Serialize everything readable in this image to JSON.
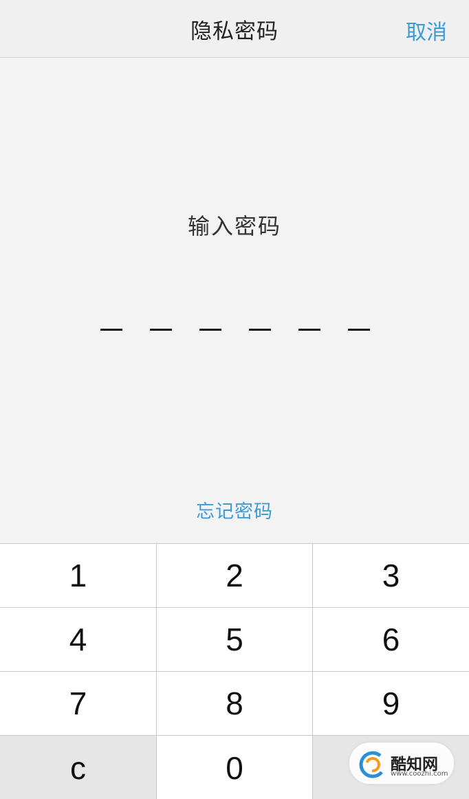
{
  "header": {
    "title": "隐私密码",
    "cancel_label": "取消"
  },
  "main": {
    "prompt": "输入密码",
    "pin_length": 6,
    "forgot_label": "忘记密码"
  },
  "keypad": {
    "keys": [
      "1",
      "2",
      "3",
      "4",
      "5",
      "6",
      "7",
      "8",
      "9",
      "c",
      "0",
      ""
    ]
  },
  "watermark": {
    "logo_text": "酷知网",
    "url": "www.coozhi.com",
    "colors": {
      "blue": "#2a8fd8",
      "orange": "#f39a1e"
    }
  },
  "colors": {
    "accent": "#3c9bd6",
    "background": "#f3f3f3",
    "keypad_bg": "#ffffff",
    "keypad_gray": "#e6e6e6"
  }
}
